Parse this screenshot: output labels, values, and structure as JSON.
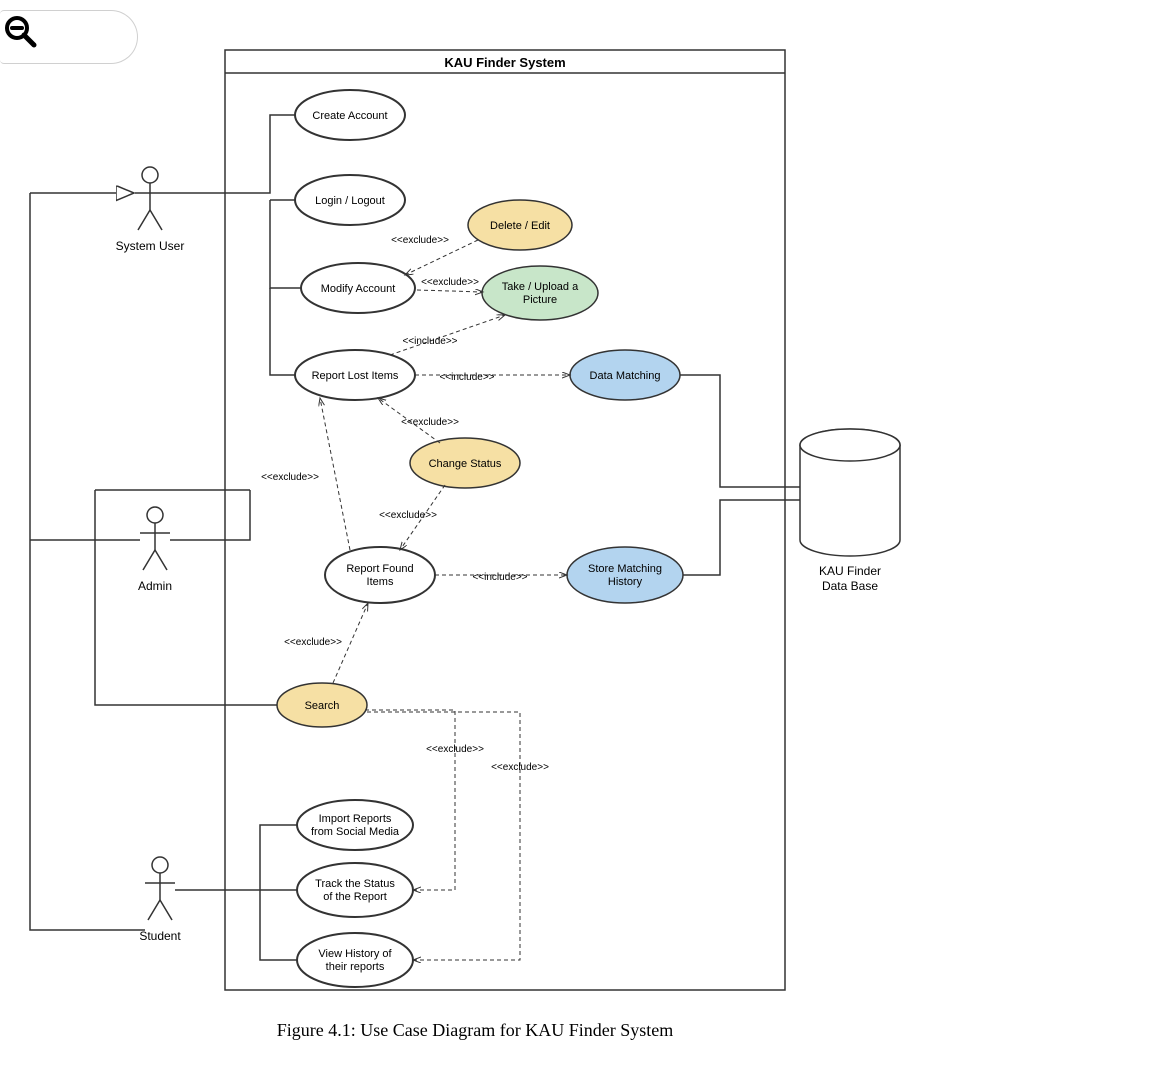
{
  "system_title": "KAU Finder System",
  "caption": "Figure 4.1: Use Case Diagram for KAU Finder System",
  "actors": {
    "system_user": "System User",
    "admin": "Admin",
    "student": "Student"
  },
  "database": {
    "line1": "KAU Finder",
    "line2": "Data Base"
  },
  "use_cases": {
    "create_account": "Create Account",
    "login_logout": "Login / Logout",
    "modify_account": "Modify Account",
    "delete_edit": "Delete / Edit",
    "take_upload_line1": "Take / Upload a",
    "take_upload_line2": "Picture",
    "report_lost": "Report Lost Items",
    "data_matching": "Data Matching",
    "change_status": "Change Status",
    "report_found_line1": "Report Found",
    "report_found_line2": "Items",
    "store_match_line1": "Store Matching",
    "store_match_line2": "History",
    "search": "Search",
    "import_line1": "Import Reports",
    "import_line2": "from Social Media",
    "track_line1": "Track the Status",
    "track_line2": "of the Report",
    "view_history_line1": "View History of",
    "view_history_line2": "their reports"
  },
  "stereotypes": {
    "exclude": "<<exclude>>",
    "include": "<<include>>"
  },
  "colors": {
    "yellow_fill": "#f6e0a4",
    "green_fill": "#c8e6c9",
    "blue_fill": "#b3d4ef",
    "white_fill": "#ffffff",
    "stroke": "#333333"
  }
}
